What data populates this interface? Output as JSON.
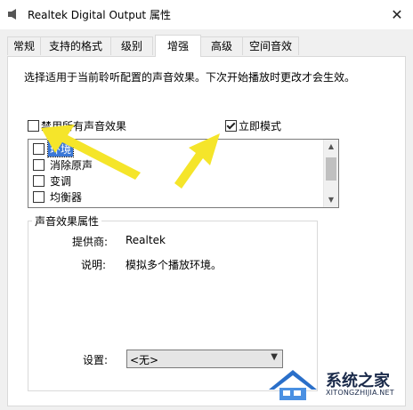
{
  "window": {
    "title": "Realtek Digital Output 属性",
    "close_glyph": "✕"
  },
  "tabs": [
    {
      "label": "常规"
    },
    {
      "label": "支持的格式"
    },
    {
      "label": "级别"
    },
    {
      "label": "增强",
      "active": true
    },
    {
      "label": "高级"
    },
    {
      "label": "空间音效"
    }
  ],
  "enhance": {
    "description": "选择适用于当前聆听配置的声音效果。下次开始播放时更改才会生效。",
    "disable_all": {
      "label": "禁用所有声音效果",
      "checked": false
    },
    "immediate_mode": {
      "label": "立即模式",
      "checked": true
    },
    "effects": [
      {
        "label": "环境",
        "checked": false,
        "selected": true
      },
      {
        "label": "消除原声",
        "checked": false
      },
      {
        "label": "变调",
        "checked": false
      },
      {
        "label": "均衡器",
        "checked": false
      }
    ]
  },
  "properties": {
    "group_title": "声音效果属性",
    "provider_label": "提供商:",
    "provider_value": "Realtek",
    "description_label": "说明:",
    "description_value": "模拟多个播放环境。",
    "settings_label": "设置:",
    "settings_value": "<无>"
  },
  "annotation": {
    "arrow_color": "#f5e52a"
  },
  "watermark": {
    "name": "系统之家",
    "url": "XITONGZHIJIA.NET"
  }
}
